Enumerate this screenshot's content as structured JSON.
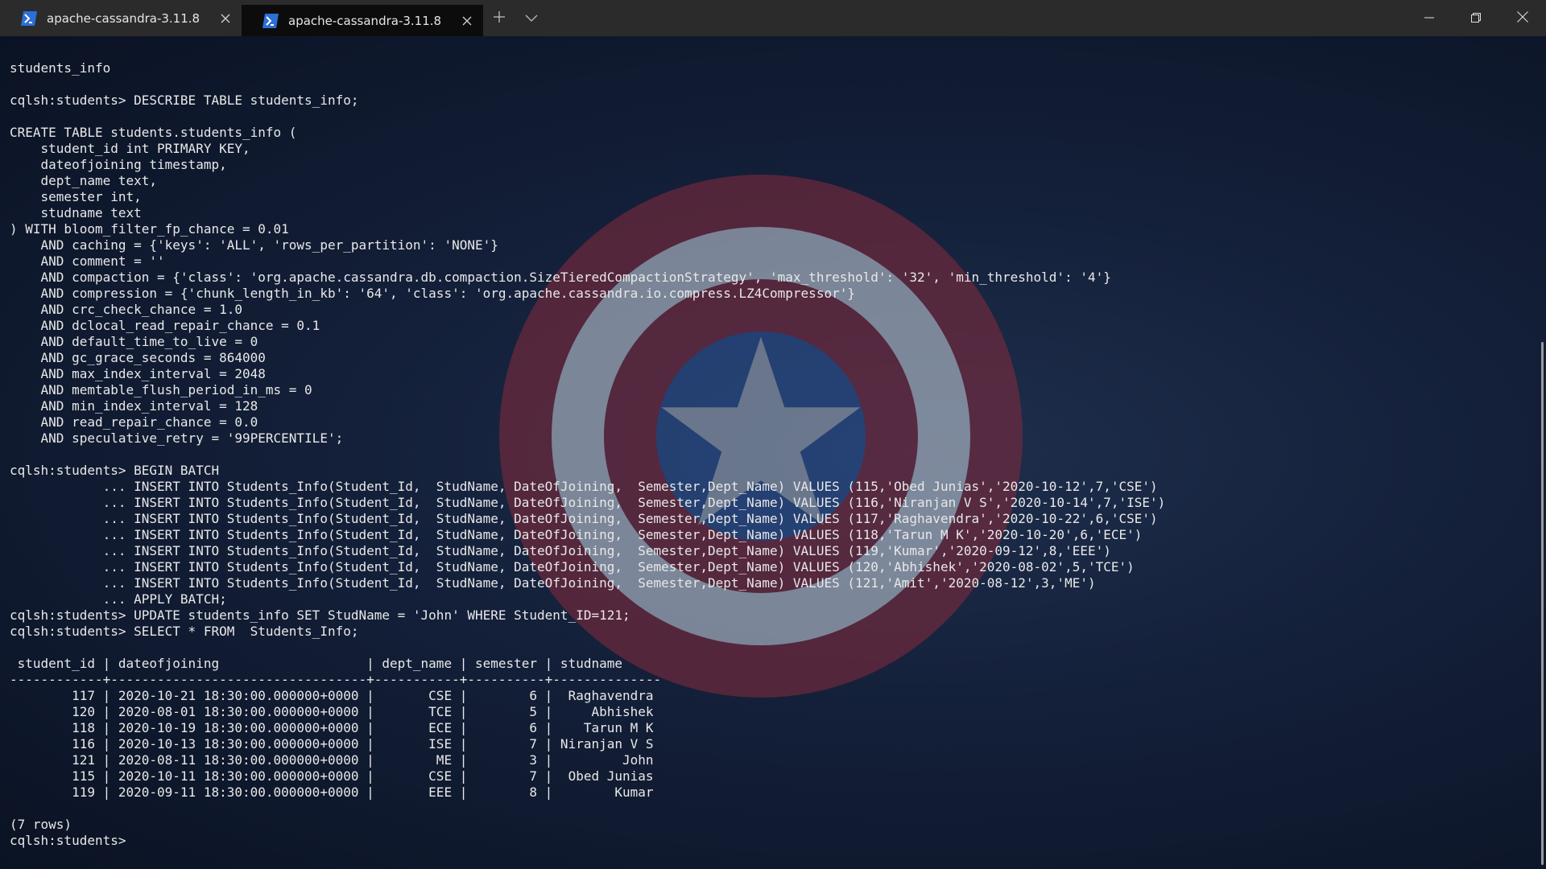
{
  "tabs": [
    {
      "label": "apache-cassandra-3.11.8",
      "icon": "powershell-icon",
      "active": false
    },
    {
      "label": "apache-cassandra-3.11.8",
      "icon": "powershell-icon",
      "active": true
    }
  ],
  "titlebar": {
    "new_tab_icon": "plus-icon",
    "dropdown_icon": "chevron-down-icon",
    "window_controls": [
      "minimize-icon",
      "restore-icon",
      "close-icon"
    ]
  },
  "terminal": {
    "lines": [
      "students_info",
      "",
      "cqlsh:students> DESCRIBE TABLE students_info;",
      "",
      "CREATE TABLE students.students_info (",
      "    student_id int PRIMARY KEY,",
      "    dateofjoining timestamp,",
      "    dept_name text,",
      "    semester int,",
      "    studname text",
      ") WITH bloom_filter_fp_chance = 0.01",
      "    AND caching = {'keys': 'ALL', 'rows_per_partition': 'NONE'}",
      "    AND comment = ''",
      "    AND compaction = {'class': 'org.apache.cassandra.db.compaction.SizeTieredCompactionStrategy', 'max_threshold': '32', 'min_threshold': '4'}",
      "    AND compression = {'chunk_length_in_kb': '64', 'class': 'org.apache.cassandra.io.compress.LZ4Compressor'}",
      "    AND crc_check_chance = 1.0",
      "    AND dclocal_read_repair_chance = 0.1",
      "    AND default_time_to_live = 0",
      "    AND gc_grace_seconds = 864000",
      "    AND max_index_interval = 2048",
      "    AND memtable_flush_period_in_ms = 0",
      "    AND min_index_interval = 128",
      "    AND read_repair_chance = 0.0",
      "    AND speculative_retry = '99PERCENTILE';",
      "",
      "cqlsh:students> BEGIN BATCH",
      "            ... INSERT INTO Students_Info(Student_Id,  StudName, DateOfJoining,  Semester,Dept_Name) VALUES (115,'Obed Junias','2020-10-12',7,'CSE')",
      "            ... INSERT INTO Students_Info(Student_Id,  StudName, DateOfJoining,  Semester,Dept_Name) VALUES (116,'Niranjan V S','2020-10-14',7,'ISE')",
      "            ... INSERT INTO Students_Info(Student_Id,  StudName, DateOfJoining,  Semester,Dept_Name) VALUES (117,'Raghavendra','2020-10-22',6,'CSE')",
      "            ... INSERT INTO Students_Info(Student_Id,  StudName, DateOfJoining,  Semester,Dept_Name) VALUES (118,'Tarun M K','2020-10-20',6,'ECE')",
      "            ... INSERT INTO Students_Info(Student_Id,  StudName, DateOfJoining,  Semester,Dept_Name) VALUES (119,'Kumar','2020-09-12',8,'EEE')",
      "            ... INSERT INTO Students_Info(Student_Id,  StudName, DateOfJoining,  Semester,Dept_Name) VALUES (120,'Abhishek','2020-08-02',5,'TCE')",
      "            ... INSERT INTO Students_Info(Student_Id,  StudName, DateOfJoining,  Semester,Dept_Name) VALUES (121,'Amit','2020-08-12',3,'ME')",
      "            ... APPLY BATCH;",
      "cqlsh:students> UPDATE students_info SET StudName = 'John' WHERE Student_ID=121;",
      "cqlsh:students> SELECT * FROM  Students_Info;",
      "",
      " student_id | dateofjoining                   | dept_name | semester | studname",
      "------------+---------------------------------+-----------+----------+--------------",
      "        117 | 2020-10-21 18:30:00.000000+0000 |       CSE |        6 |  Raghavendra",
      "        120 | 2020-08-01 18:30:00.000000+0000 |       TCE |        5 |     Abhishek",
      "        118 | 2020-10-19 18:30:00.000000+0000 |       ECE |        6 |    Tarun M K",
      "        116 | 2020-10-13 18:30:00.000000+0000 |       ISE |        7 | Niranjan V S",
      "        121 | 2020-08-11 18:30:00.000000+0000 |        ME |        3 |         John",
      "        115 | 2020-10-11 18:30:00.000000+0000 |       CSE |        7 |  Obed Junias",
      "        119 | 2020-09-11 18:30:00.000000+0000 |       EEE |        8 |        Kumar",
      "",
      "(7 rows)",
      "cqlsh:students> "
    ]
  },
  "background": {
    "image": "captain-america-shield",
    "base_color": "#121e36"
  }
}
